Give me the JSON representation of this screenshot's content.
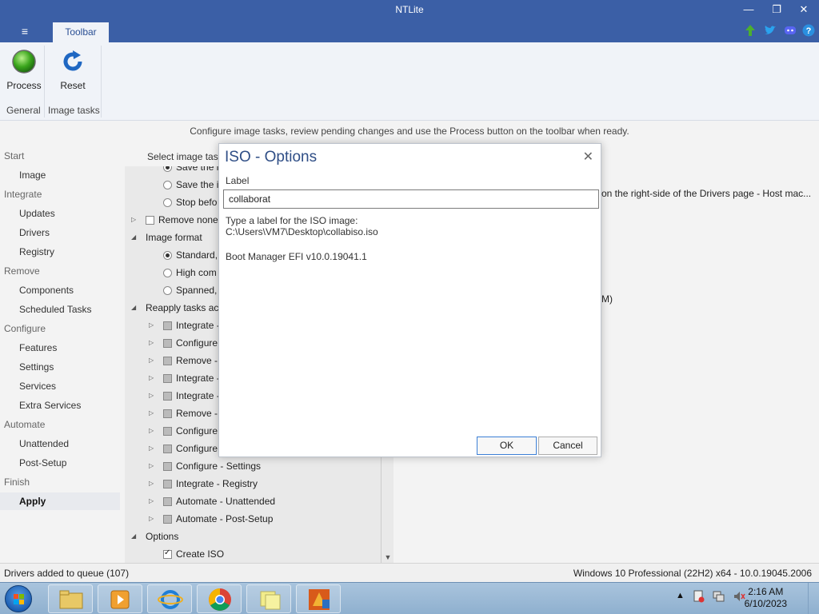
{
  "window": {
    "title": "NTLite",
    "minimize": "—",
    "restore": "❐",
    "close": "✕"
  },
  "ribbon": {
    "menu_icon": "≡",
    "tab_label": "Toolbar",
    "process_label": "Process",
    "reset_label": "Reset",
    "group_general": "General",
    "group_image_tasks": "Image tasks"
  },
  "info_line": "Configure image tasks, review pending changes and use the Process button on the toolbar when ready.",
  "nav": {
    "items": [
      {
        "label": "Start",
        "type": "cat"
      },
      {
        "label": "Image",
        "type": "sub"
      },
      {
        "label": "Integrate",
        "type": "cat"
      },
      {
        "label": "Updates",
        "type": "sub"
      },
      {
        "label": "Drivers",
        "type": "sub"
      },
      {
        "label": "Registry",
        "type": "sub"
      },
      {
        "label": "Remove",
        "type": "cat"
      },
      {
        "label": "Components",
        "type": "sub"
      },
      {
        "label": "Scheduled Tasks",
        "type": "sub"
      },
      {
        "label": "Configure",
        "type": "cat"
      },
      {
        "label": "Features",
        "type": "sub"
      },
      {
        "label": "Settings",
        "type": "sub"
      },
      {
        "label": "Services",
        "type": "sub"
      },
      {
        "label": "Extra Services",
        "type": "sub"
      },
      {
        "label": "Automate",
        "type": "cat"
      },
      {
        "label": "Unattended",
        "type": "sub"
      },
      {
        "label": "Post-Setup",
        "type": "sub"
      },
      {
        "label": "Finish",
        "type": "cat"
      },
      {
        "label": "Apply",
        "type": "sub"
      }
    ]
  },
  "tree": {
    "select_label": "Select image task",
    "rows": [
      {
        "text": "Save the i",
        "control": "radio",
        "checked": true
      },
      {
        "text": "Save the i",
        "control": "radio",
        "checked": false
      },
      {
        "text": "Stop befo",
        "control": "radio",
        "checked": false
      },
      {
        "text": "Remove none",
        "control": "checkbox",
        "checked": false
      },
      {
        "text": "Image format",
        "control": "none"
      },
      {
        "text": "Standard,",
        "control": "radio",
        "checked": true
      },
      {
        "text": "High com",
        "control": "radio",
        "checked": false
      },
      {
        "text": "Spanned,",
        "control": "radio",
        "checked": false
      },
      {
        "text": "Reapply tasks acr",
        "control": "none"
      },
      {
        "text": "Integrate -",
        "control": "checkbox",
        "state": "partial"
      },
      {
        "text": "Configure",
        "control": "checkbox",
        "state": "partial"
      },
      {
        "text": "Remove -",
        "control": "checkbox",
        "state": "partial"
      },
      {
        "text": "Integrate -",
        "control": "checkbox",
        "state": "partial"
      },
      {
        "text": "Integrate -",
        "control": "checkbox",
        "state": "partial"
      },
      {
        "text": "Remove -",
        "control": "checkbox",
        "state": "partial"
      },
      {
        "text": "Configure",
        "control": "checkbox",
        "state": "partial"
      },
      {
        "text": "Configure",
        "control": "checkbox",
        "state": "partial"
      },
      {
        "text": "Configure - Settings",
        "control": "checkbox",
        "state": "partial"
      },
      {
        "text": "Integrate - Registry",
        "control": "checkbox",
        "state": "partial"
      },
      {
        "text": "Automate - Unattended",
        "control": "checkbox",
        "state": "partial"
      },
      {
        "text": "Automate - Post-Setup",
        "control": "checkbox",
        "state": "partial"
      },
      {
        "text": "Options",
        "control": "none"
      },
      {
        "text": "Create ISO",
        "control": "checkbox",
        "checked": true
      }
    ]
  },
  "right_panel": {
    "drivers_note": "on the right-side of the Drivers page - Host mac...",
    "fragment": "M)"
  },
  "dialog": {
    "title": "ISO - Options",
    "label_caption": "Label",
    "label_value": "collaborat",
    "help_line1": "Type a label for the ISO image:",
    "help_line2": "C:\\Users\\VM7\\Desktop\\collabiso.iso",
    "boot_manager": "Boot Manager EFI v10.0.19041.1",
    "ok_label": "OK",
    "cancel_label": "Cancel"
  },
  "status": {
    "left": "Drivers added to queue (107)",
    "right": "Windows 10 Professional (22H2) x64 - 10.0.19045.2006"
  },
  "taskbar": {
    "time": "2:16 AM",
    "date": "6/10/2023"
  },
  "colors": {
    "titlebar": "#3b5fa6",
    "accent": "#2f4e86"
  }
}
